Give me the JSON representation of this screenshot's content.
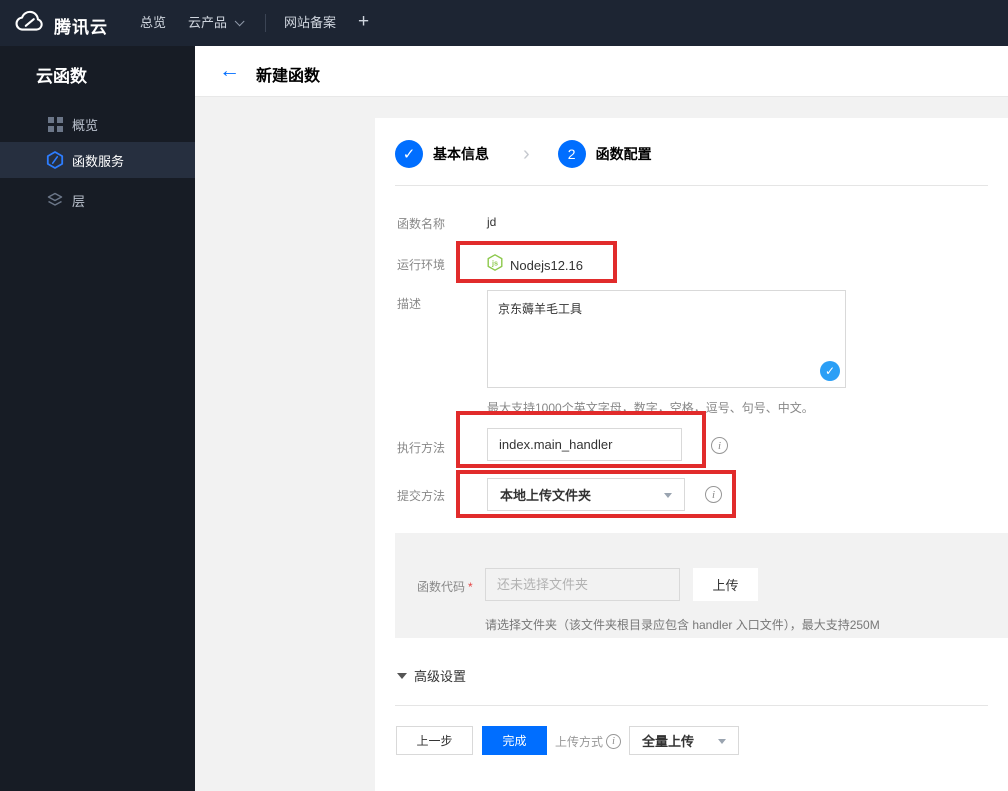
{
  "topbar": {
    "brand": "腾讯云",
    "nav": [
      {
        "label": "总览"
      },
      {
        "label": "云产品"
      },
      {
        "label": "网站备案"
      },
      {
        "label": "+"
      }
    ]
  },
  "sidebar": {
    "title": "云函数",
    "items": [
      {
        "label": "概览"
      },
      {
        "label": "函数服务"
      },
      {
        "label": "层"
      }
    ]
  },
  "header": {
    "title": "新建函数"
  },
  "stepper": {
    "step1_label": "基本信息",
    "step2_number": "2",
    "step2_label": "函数配置"
  },
  "form": {
    "name_label": "函数名称",
    "name_value": "jd",
    "runtime_label": "运行环境",
    "runtime_value": "Nodejs12.16",
    "desc_label": "描述",
    "desc_value": "京东薅羊毛工具",
    "desc_helper": "最大支持1000个英文字母，数字，空格，逗号、句号、中文。",
    "handler_label": "执行方法",
    "handler_value": "index.main_handler",
    "submit_label": "提交方法",
    "submit_value": "本地上传文件夹",
    "code_label": "函数代码",
    "required_mark": "*",
    "code_placeholder": "还未选择文件夹",
    "upload_button": "上传",
    "code_helper": "请选择文件夹（该文件夹根目录应包含 handler 入口文件），最大支持250M"
  },
  "advanced_label": "高级设置",
  "footer": {
    "prev_button": "上一步",
    "finish_button": "完成",
    "upload_mode_label": "上传方式",
    "upload_mode_value": "全量上传"
  },
  "icons": {
    "back_arrow": "←",
    "chevron_right": "›",
    "check": "✓",
    "info": "i"
  },
  "colors": {
    "accent_blue": "#006eff",
    "annotation_red": "#e12b2b",
    "node_green": "#8cc84b",
    "topbar_bg": "#1d2533",
    "sidebar_bg": "#171c25"
  }
}
